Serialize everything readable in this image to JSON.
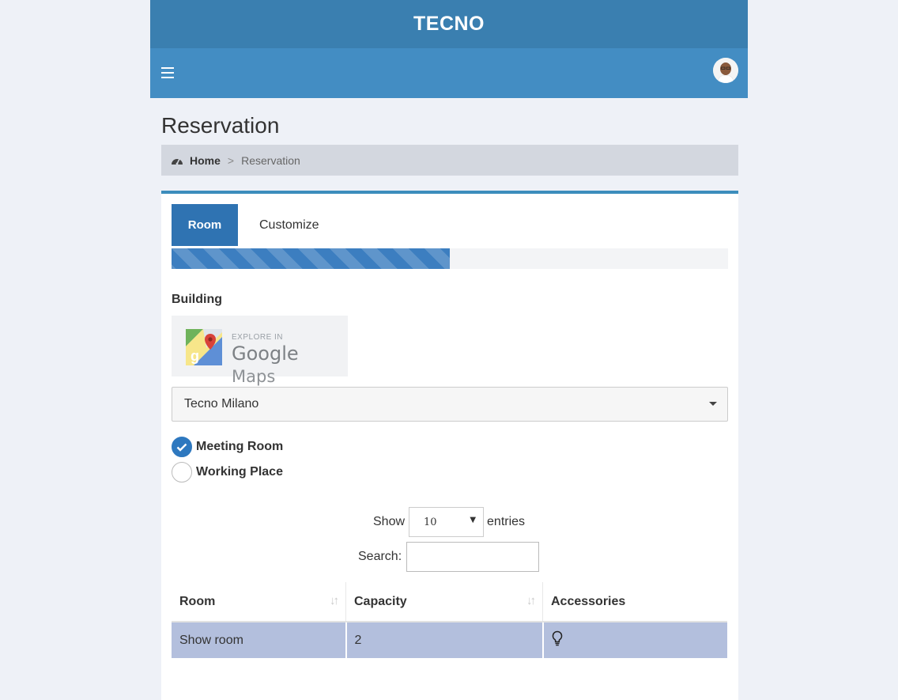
{
  "app": {
    "brand": "TECNO"
  },
  "page": {
    "title": "Reservation"
  },
  "breadcrumb": {
    "home": "Home",
    "separator": ">",
    "current": "Reservation"
  },
  "tabs": [
    {
      "label": "Room",
      "active": true
    },
    {
      "label": "Customize",
      "active": false
    }
  ],
  "progress": {
    "percent": 50
  },
  "building": {
    "label": "Building",
    "maps_button": {
      "top_text": "EXPLORE IN",
      "google": "Google",
      "maps": "Maps"
    },
    "selected": "Tecno Milano"
  },
  "room_type": {
    "options": [
      {
        "label": "Meeting Room",
        "checked": true
      },
      {
        "label": "Working Place",
        "checked": false
      }
    ]
  },
  "table_controls": {
    "show_label": "Show",
    "entries_value": "10",
    "entries_label": "entries",
    "search_label": "Search:",
    "search_value": ""
  },
  "table": {
    "columns": [
      "Room",
      "Capacity",
      "Accessories"
    ],
    "rows": [
      {
        "room": "Show room",
        "capacity": "2",
        "accessories": "lightbulb-icon"
      }
    ]
  },
  "colors": {
    "brand_bar": "#3a7fb0",
    "nav_bar": "#438dc3",
    "accent": "#2f73b2",
    "row_highlight": "#b3bfdd"
  }
}
